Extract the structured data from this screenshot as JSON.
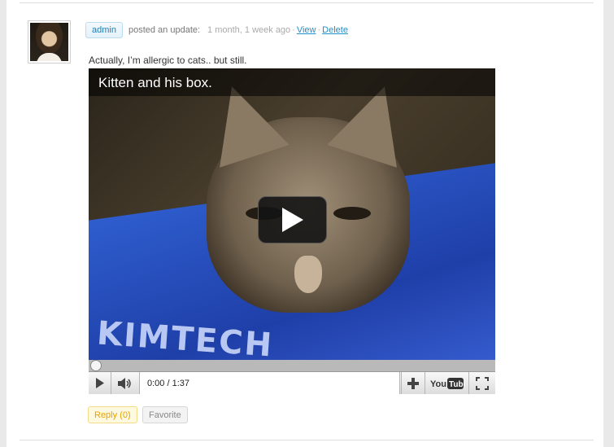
{
  "activity": {
    "username": "admin",
    "action": "posted an update:",
    "timestamp": "1 month, 1 week ago",
    "separator": "·",
    "view_label": "View",
    "delete_label": "Delete",
    "content": "Actually, I’m allergic to cats.. but still."
  },
  "video": {
    "title": "Kitten and his box.",
    "time": "0:00 / 1:37",
    "box_text": "KIMTECH",
    "progress": 0,
    "icons": [
      "play-icon",
      "volume-icon",
      "plus-icon",
      "youtube-logo",
      "fullscreen-icon"
    ]
  },
  "actions": {
    "reply_label": "Reply (0)",
    "favorite_label": "Favorite"
  },
  "colors": {
    "link": "#1e8fc7",
    "reply": "#e6a200",
    "user_pill": "#1e7fb8"
  }
}
